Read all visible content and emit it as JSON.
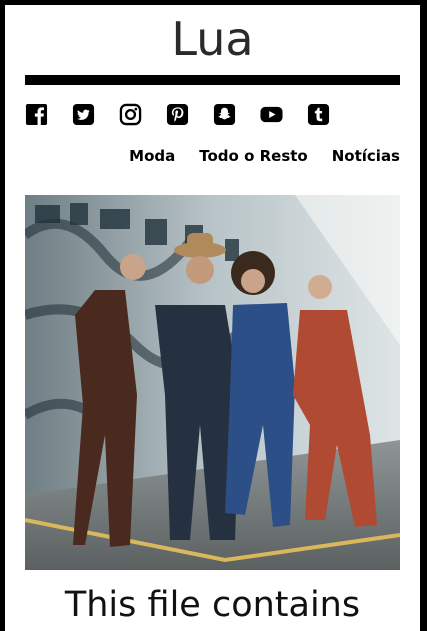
{
  "site": {
    "title": "Lua"
  },
  "social": [
    {
      "name": "facebook-icon"
    },
    {
      "name": "twitter-icon"
    },
    {
      "name": "instagram-icon"
    },
    {
      "name": "pinterest-icon"
    },
    {
      "name": "snapchat-icon"
    },
    {
      "name": "youtube-icon"
    },
    {
      "name": "tumblr-icon"
    }
  ],
  "nav": [
    {
      "label": "Moda"
    },
    {
      "label": "Todo o Resto"
    },
    {
      "label": "Notícias"
    }
  ],
  "article": {
    "headline": "This file contains"
  },
  "colors": {
    "frame": "#000000",
    "title": "#2a2a2a",
    "rule": "#000000"
  }
}
